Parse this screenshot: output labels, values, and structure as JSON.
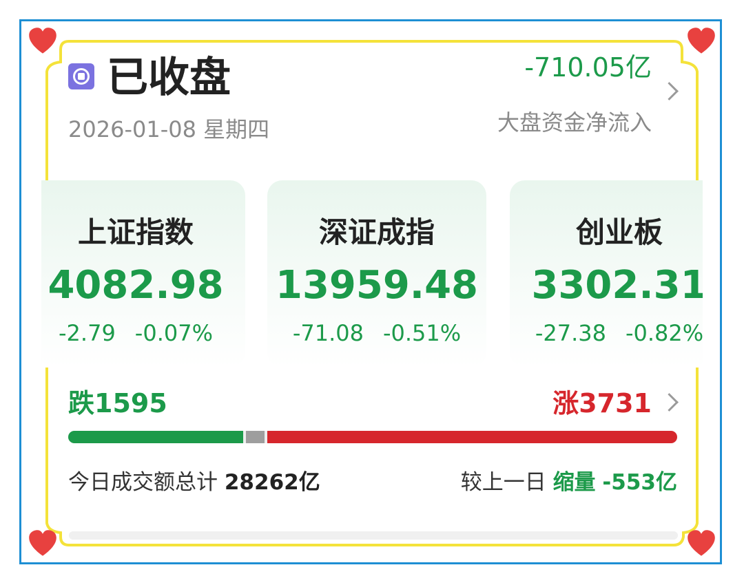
{
  "header": {
    "status": "已收盘",
    "date": "2026-01-08 星期四",
    "net_flow_value": "-710.05亿",
    "net_flow_label": "大盘资金净流入"
  },
  "indices": [
    {
      "name": "上证指数",
      "value": "4082.98",
      "change": "-2.79",
      "change_pct": "-0.07%"
    },
    {
      "name": "深证成指",
      "value": "13959.48",
      "change": "-71.08",
      "change_pct": "-0.51%"
    },
    {
      "name": "创业板",
      "value": "3302.31",
      "change": "-27.38",
      "change_pct": "-0.82%"
    }
  ],
  "breadth": {
    "fall_label": "跌1595",
    "rise_label": "涨3731",
    "fall": 1595,
    "rise": 3731,
    "flat_share": 0.03
  },
  "turnover": {
    "label": "今日成交额总计",
    "value": "28262亿",
    "compare_prefix": "较上一日",
    "compare_tag": "缩量",
    "compare_value": "-553亿"
  },
  "colors": {
    "down": "#1c9a4a",
    "up": "#d6262c",
    "flat": "#9e9e9e",
    "frame_yellow": "#f4e23a",
    "frame_blue": "#1e8fd4",
    "heart": "#e8413f"
  }
}
